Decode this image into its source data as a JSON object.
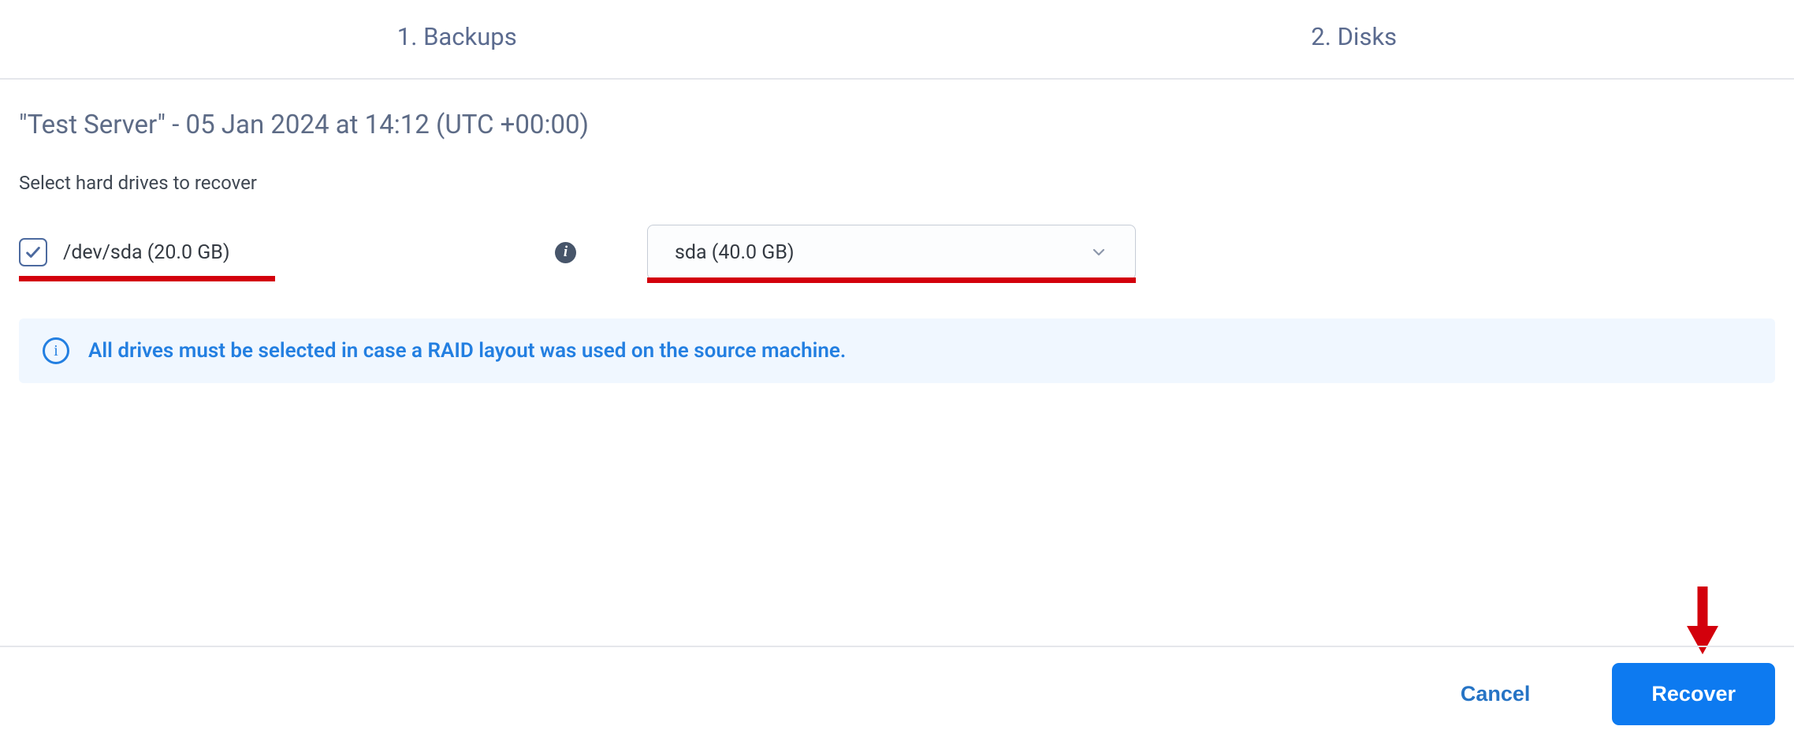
{
  "steps": {
    "one": "1. Backups",
    "two": "2. Disks"
  },
  "heading": "\"Test Server\" - 05 Jan 2024 at 14:12 (UTC +00:00)",
  "subheading": "Select hard drives to recover",
  "drive": {
    "checked": true,
    "label": "/dev/sda (20.0 GB)"
  },
  "target_dropdown": {
    "selected": "sda (40.0 GB)"
  },
  "info_banner": "All drives must be selected in case a RAID layout was used on the source machine.",
  "footer": {
    "cancel": "Cancel",
    "recover": "Recover"
  },
  "colors": {
    "accent": "#0d7af0",
    "annotation": "#d3000c",
    "info_text": "#237fe1"
  }
}
